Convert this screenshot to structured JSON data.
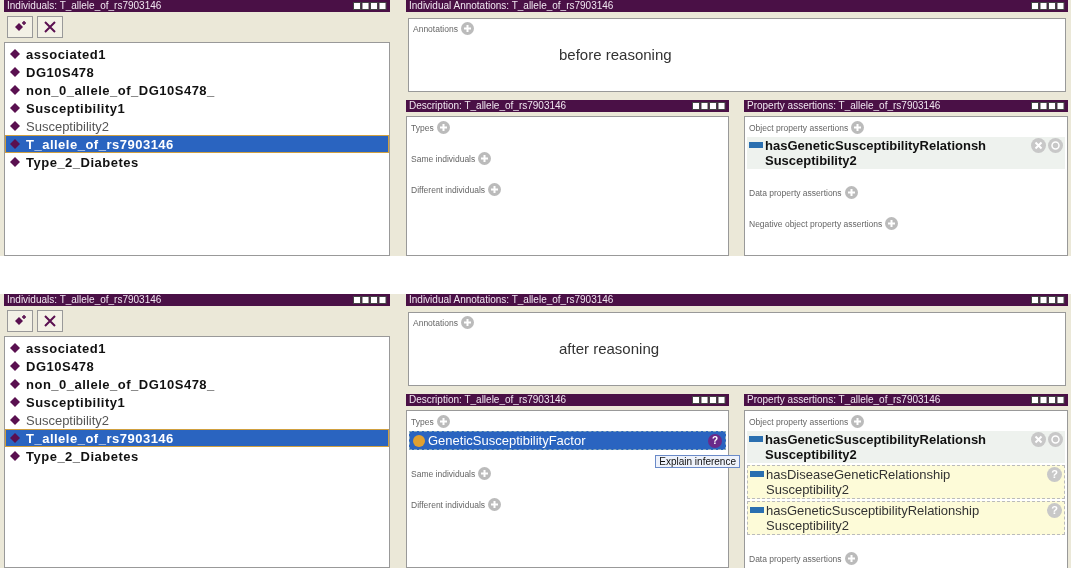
{
  "snapshots": [
    {
      "individuals": {
        "title": "Individuals: T_allele_of_rs7903146",
        "items": [
          {
            "label": "associated1",
            "bold": true,
            "selected": false
          },
          {
            "label": "DG10S478",
            "bold": true,
            "selected": false
          },
          {
            "label": "non_0_allele_of_DG10S478_",
            "bold": true,
            "selected": false
          },
          {
            "label": "Susceptibility1",
            "bold": true,
            "selected": false
          },
          {
            "label": "Susceptibility2",
            "bold": false,
            "selected": false
          },
          {
            "label": "T_allele_of_rs7903146",
            "bold": true,
            "selected": true
          },
          {
            "label": "Type_2_Diabetes",
            "bold": true,
            "selected": false
          }
        ]
      },
      "annotations": {
        "title": "Individual Annotations: T_allele_of_rs7903146",
        "label": "Annotations",
        "caption": "before reasoning"
      },
      "description": {
        "title": "Description: T_allele_of_rs7903146",
        "sections": [
          {
            "label": "Types"
          },
          {
            "label": "Same individuals"
          },
          {
            "label": "Different individuals"
          }
        ]
      },
      "properties": {
        "title": "Property assertions: T_allele_of_rs7903146",
        "sections": [
          {
            "label": "Object property assertions",
            "items": [
              {
                "property": "hasGeneticSusceptibilityRelationsh",
                "value": "Susceptibility2",
                "inferred": false
              }
            ]
          },
          {
            "label": "Data property assertions"
          },
          {
            "label": "Negative object property assertions"
          }
        ]
      }
    },
    {
      "individuals": {
        "title": "Individuals: T_allele_of_rs7903146",
        "items": [
          {
            "label": "associated1",
            "bold": true,
            "selected": false
          },
          {
            "label": "DG10S478",
            "bold": true,
            "selected": false
          },
          {
            "label": "non_0_allele_of_DG10S478_",
            "bold": true,
            "selected": false
          },
          {
            "label": "Susceptibility1",
            "bold": true,
            "selected": false
          },
          {
            "label": "Susceptibility2",
            "bold": false,
            "selected": false
          },
          {
            "label": "T_allele_of_rs7903146",
            "bold": true,
            "selected": true
          },
          {
            "label": "Type_2_Diabetes",
            "bold": true,
            "selected": false
          }
        ]
      },
      "annotations": {
        "title": "Individual Annotations: T_allele_of_rs7903146",
        "label": "Annotations",
        "caption": "after reasoning"
      },
      "description": {
        "title": "Description: T_allele_of_rs7903146",
        "tooltip": "Explain inference",
        "sections": [
          {
            "label": "Types",
            "items": [
              {
                "label": "GeneticSusceptibilityFactor",
                "inferred": true,
                "selected": true,
                "help": "?"
              }
            ]
          },
          {
            "label": "Same individuals"
          },
          {
            "label": "Different individuals"
          }
        ]
      },
      "properties": {
        "title": "Property assertions: T_allele_of_rs7903146",
        "sections": [
          {
            "label": "Object property assertions",
            "items": [
              {
                "property": "hasGeneticSusceptibilityRelationsh",
                "value": "Susceptibility2",
                "inferred": false
              },
              {
                "property": "hasDiseaseGeneticRelationship",
                "value": "Susceptibility2",
                "inferred": true,
                "help": "?"
              },
              {
                "property": "hasGeneticSusceptibilityRelationship",
                "value": "Susceptibility2",
                "inferred": true,
                "help": "?"
              }
            ]
          },
          {
            "label": "Data property assertions"
          }
        ]
      }
    }
  ]
}
